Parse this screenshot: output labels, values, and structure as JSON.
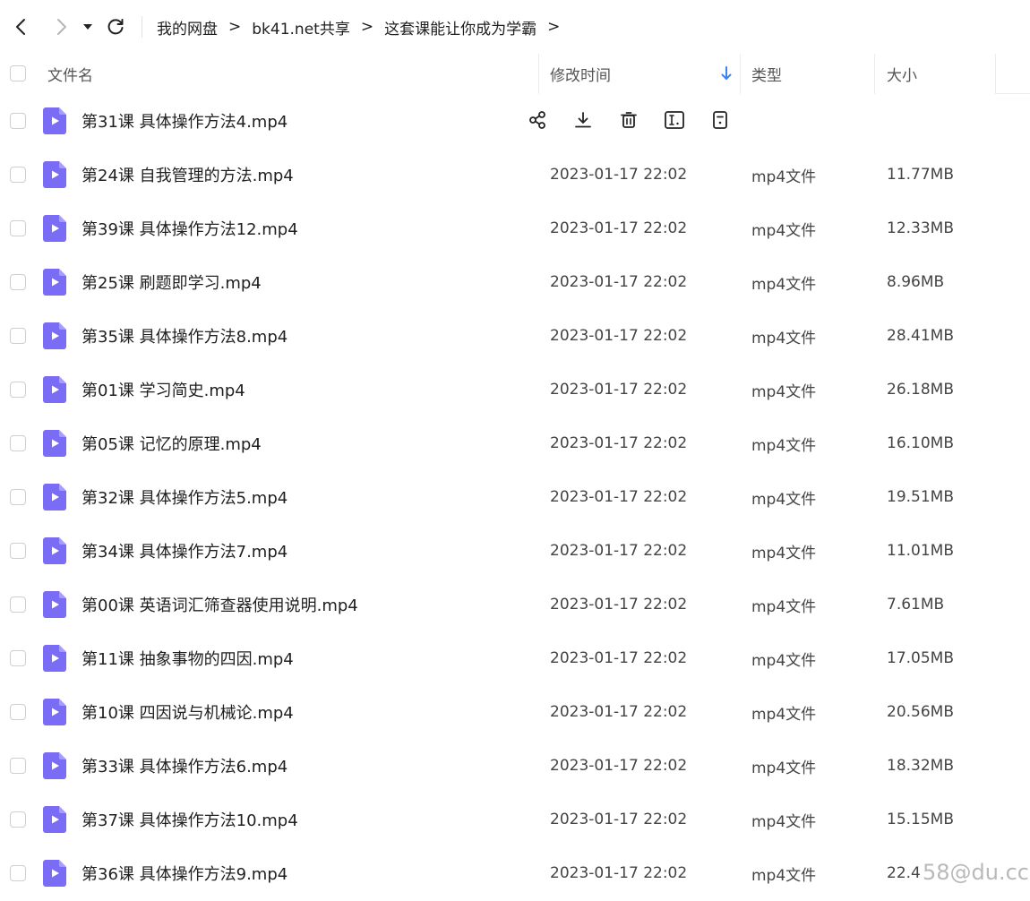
{
  "breadcrumb": [
    "我的网盘",
    "bk41.net共享",
    "这套课能让你成为学霸"
  ],
  "breadcrumb_sep": ">",
  "columns": {
    "name": "文件名",
    "time": "修改时间",
    "type": "类型",
    "size": "大小"
  },
  "files": [
    {
      "name": "第31课 具体操作方法4.mp4",
      "time": "",
      "type": "",
      "size": "",
      "hovered": true
    },
    {
      "name": "第24课 自我管理的方法.mp4",
      "time": "2023-01-17 22:02",
      "type": "mp4文件",
      "size": "11.77MB"
    },
    {
      "name": "第39课 具体操作方法12.mp4",
      "time": "2023-01-17 22:02",
      "type": "mp4文件",
      "size": "12.33MB"
    },
    {
      "name": "第25课 刷题即学习.mp4",
      "time": "2023-01-17 22:02",
      "type": "mp4文件",
      "size": "8.96MB"
    },
    {
      "name": "第35课 具体操作方法8.mp4",
      "time": "2023-01-17 22:02",
      "type": "mp4文件",
      "size": "28.41MB"
    },
    {
      "name": "第01课 学习简史.mp4",
      "time": "2023-01-17 22:02",
      "type": "mp4文件",
      "size": "26.18MB"
    },
    {
      "name": "第05课 记忆的原理.mp4",
      "time": "2023-01-17 22:02",
      "type": "mp4文件",
      "size": "16.10MB"
    },
    {
      "name": "第32课 具体操作方法5.mp4",
      "time": "2023-01-17 22:02",
      "type": "mp4文件",
      "size": "19.51MB"
    },
    {
      "name": "第34课 具体操作方法7.mp4",
      "time": "2023-01-17 22:02",
      "type": "mp4文件",
      "size": "11.01MB"
    },
    {
      "name": "第00课 英语词汇筛查器使用说明.mp4",
      "time": "2023-01-17 22:02",
      "type": "mp4文件",
      "size": "7.61MB"
    },
    {
      "name": "第11课 抽象事物的四因.mp4",
      "time": "2023-01-17 22:02",
      "type": "mp4文件",
      "size": "17.05MB"
    },
    {
      "name": "第10课 四因说与机械论.mp4",
      "time": "2023-01-17 22:02",
      "type": "mp4文件",
      "size": "20.56MB"
    },
    {
      "name": "第33课 具体操作方法6.mp4",
      "time": "2023-01-17 22:02",
      "type": "mp4文件",
      "size": "18.32MB"
    },
    {
      "name": "第37课 具体操作方法10.mp4",
      "time": "2023-01-17 22:02",
      "type": "mp4文件",
      "size": "15.15MB"
    },
    {
      "name": "第36课 具体操作方法9.mp4",
      "time": "2023-01-17 22:02",
      "type": "mp4文件",
      "size": "22.4"
    }
  ],
  "hover_actions": [
    "share-icon",
    "download-icon",
    "delete-icon",
    "rename-icon",
    "more-icon"
  ],
  "watermark": "58@du.cc",
  "colors": {
    "file_icon": "#7b6cf6",
    "sort_arrow": "#3b82f6"
  }
}
